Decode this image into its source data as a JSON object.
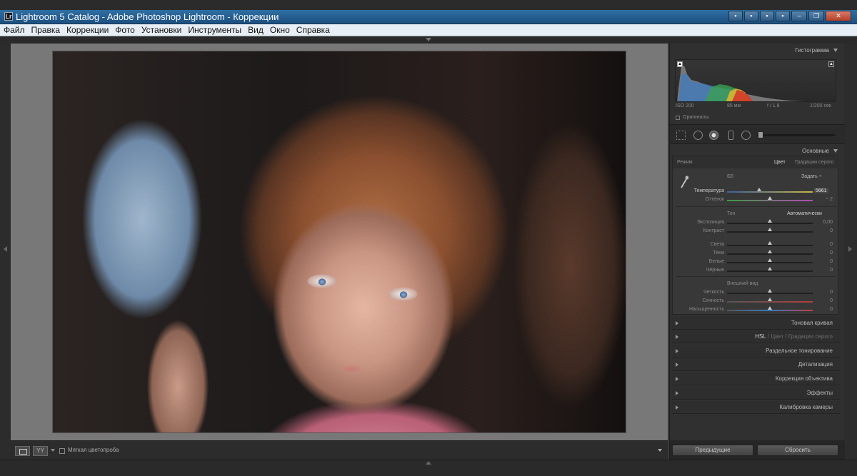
{
  "window": {
    "title": "Lightroom 5 Catalog - Adobe Photoshop Lightroom - Коррекции",
    "app_icon": "Lr"
  },
  "menu": [
    "Файл",
    "Правка",
    "Коррекции",
    "Фото",
    "Установки",
    "Инструменты",
    "Вид",
    "Окно",
    "Справка"
  ],
  "toolbar": {
    "view_btn_b": "YY",
    "softproof_label": "Мягкая цветопроба"
  },
  "right_panel": {
    "histogram": {
      "header": "Гистограмма",
      "iso": "ISO 200",
      "focal": "85 мм",
      "aperture": "f / 1.8",
      "shutter": "1/200 сек",
      "original_label": "Оригиналы"
    },
    "basic": {
      "header": "Основные",
      "treatment_label": "Режим",
      "treatment_color": "Цвет",
      "treatment_bw": "Градации серого",
      "wb_label": "ББ",
      "wb_value": "Задать ÷",
      "temperature_label": "Температура",
      "temperature_value": "5661",
      "tint_label": "Оттенок",
      "tint_value": "− 2",
      "tone_label": "Тон",
      "auto_label": "Автоматически",
      "exposure_label": "Экспозиция",
      "exposure_value": "0,00",
      "contrast_label": "Контраст",
      "contrast_value": "0",
      "highlights_label": "Света",
      "highlights_value": "0",
      "shadows_label": "Тени",
      "shadows_value": "0",
      "whites_label": "Белые",
      "whites_value": "0",
      "blacks_label": "Чёрные",
      "blacks_value": "0",
      "presence_label": "Внешний вид",
      "clarity_label": "Четкость",
      "clarity_value": "0",
      "vibrance_label": "Сочность",
      "vibrance_value": "0",
      "saturation_label": "Насыщенность",
      "saturation_value": "0"
    },
    "collapsed_panels": {
      "tone_curve": "Тоновая кривая",
      "hsl": "HSL",
      "hsl_color": "Цвет",
      "hsl_gray": "Градации серого",
      "split_toning": "Раздельное тонирование",
      "detail": "Детализация",
      "lens": "Коррекция объектива",
      "effects": "Эффекты",
      "camera_cal": "Калибровка камеры"
    },
    "buttons": {
      "previous": "Предыдущие",
      "reset": "Сбросить"
    }
  }
}
